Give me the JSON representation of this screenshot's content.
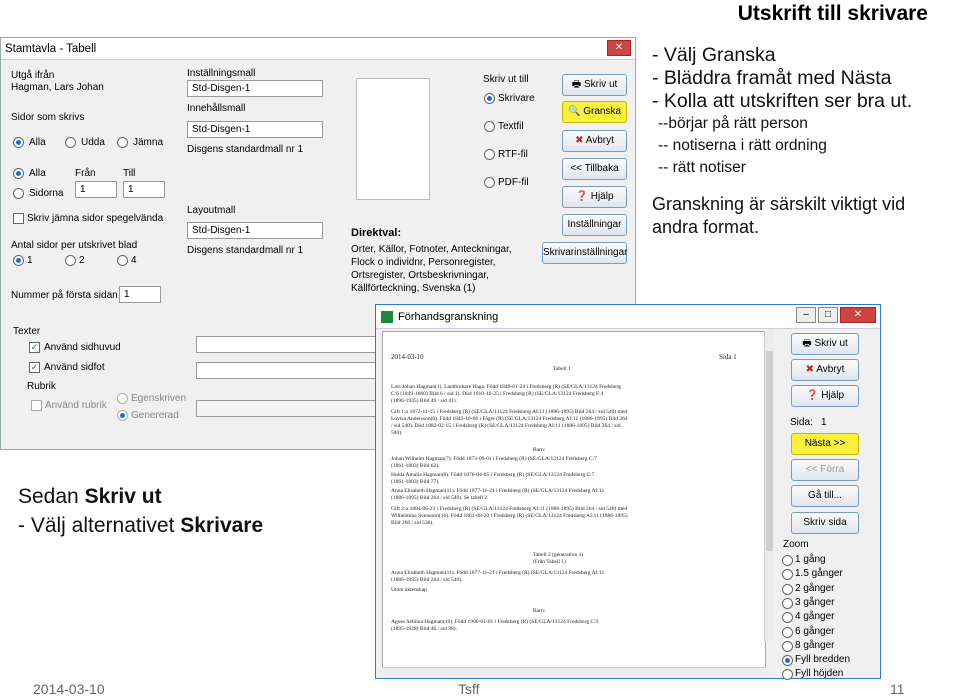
{
  "slide_title": "Utskrift till skrivare",
  "notes": {
    "l1": "- Välj Granska",
    "l2": "- Bläddra framåt med Nästa",
    "l3": "- Kolla att utskriften ser bra ut.",
    "s1": "--börjar på rätt person",
    "s2": "-- notiserna i rätt ordning",
    "s3": "-- rätt notiser",
    "para": "Granskning är särskilt viktigt vid andra format."
  },
  "bottom": {
    "l1a": "Sedan ",
    "l1b": "Skriv ut",
    "l2a": "- Välj alternativet ",
    "l2b": "Skrivare"
  },
  "footer": {
    "date": "2014-03-10",
    "center": "Tsff",
    "page": "11"
  },
  "dialog1": {
    "title": "Stamtavla - Tabell",
    "utgå_label": "Utgå ifrån",
    "utgå_value": "Hagman, Lars Johan",
    "sidor_label": "Sidor som skrivs",
    "alla": "Alla",
    "udda": "Udda",
    "jamna": "Jämna",
    "alla2": "Alla",
    "sidorna": "Sidorna",
    "fran": "Från",
    "fran_val": "1",
    "till": "Till",
    "till_val": "1",
    "skriv_jamna": "Skriv jämna sidor spegelvända",
    "antal_label": "Antal sidor per utskrivet blad",
    "a1": "1",
    "a2": "2",
    "a4": "4",
    "nummer_label": "Nummer på första sidan",
    "nummer_val": "1",
    "installningsmall_label": "Inställningsmall",
    "installningsmall_val": "Std-Disgen-1",
    "innehallsmall_label": "Innehållsmall",
    "innehallsmall_val": "Std-Disgen-1",
    "innehall_desc": "Disgens standardmall nr 1",
    "layoutmall_label": "Layoutmall",
    "layoutmall_val": "Std-Disgen-1",
    "layout_desc": "Disgens standardmall nr 1",
    "skriv_ut_till": "Skriv ut till",
    "skrivare": "Skrivare",
    "textfil": "Textfil",
    "rtf": "RTF-fil",
    "pdf": "PDF-fil",
    "btn_skriv": "Skriv ut",
    "btn_granska": "Granska",
    "btn_avbryt": "Avbryt",
    "btn_tillbaka": "<< Tillbaka",
    "btn_hjalp": "Hjälp",
    "btn_installningar": "Inställningar",
    "btn_skrivarinst": "Skrivarinställningar",
    "direktval_label": "Direktval:",
    "direktval_text": "Orter, Källor, Fotnoter, Anteckningar, Flock o individnr, Personregister, Ortsregister, Ortsbeskrivningar, Källförteckning, Svenska (1)",
    "texter_label": "Texter",
    "sidhuvud": "Använd sidhuvud",
    "sidfot": "Använd sidfot",
    "rubrik_label": "Rubrik",
    "anvand_rubrik": "Använd rubrik",
    "egenskriven": "Egenskriven",
    "genererad": "Genererad"
  },
  "dialog2": {
    "title": "Förhandsgranskning",
    "btn_skriv": "Skriv ut",
    "btn_avbryt": "Avbryt",
    "btn_hjalp": "Hjälp",
    "sida_label": "Sida:",
    "sida_val": "1",
    "btn_nasta": "Nästa >>",
    "btn_forra": "<< Förra",
    "btn_gatill": "Gå till...",
    "btn_skrivsida": "Skriv sida",
    "zoom_label": "Zoom",
    "zoom_options": [
      "1 gång",
      "1.5 gånger",
      "2 gånger",
      "3 gånger",
      "4 gånger",
      "6 gånger",
      "8 gånger",
      "Fyll bredden",
      "Fyll höjden"
    ],
    "page": {
      "date": "2014-03-10",
      "sida": "Sida 1",
      "tabell": "Tabell 1",
      "lines": [
        "Lars Johan Hagman(1). Lantbrukare Haga. Född 1849-01-24 i Fredsberg (R) (SE/GLA/13124 Fredsberg",
        "C:6 (1849-1860) Bild 6 / sid 1). Död 1910-10-25 i Fredsberg (R) (SE/GLA/13124 Fredsberg F:4",
        "(1896-1935) Bild 49 / sid 41).",
        "Gift 1:o 1872-11-15 i Fredsberg (R) (SE/GLA/13124 Fredsberg AI:11 (1886-1895) Bild 264 / sid 540) med",
        "Lovisa Andersson(6). Född 1845-10-06 i Fågre (R) (SE/GLA/13124 Fredsberg AI:11 (1886-1895) Bild 264",
        "/ sid 540). Död 1882-02-15 i Fredsberg (R) (SE/GLA/13124 Fredsberg AI:11 (1886-1895) Bild 264 / sid",
        "540).",
        "Barn:",
        "Johan Wilhelm Hagman(7). Född 1873-09-01 i Fredsberg (R) (SE/GLA/13124 Fredsberg C:7",
        "(1861-1883) Bild 62).",
        "Hulda Amalia Hagman(8). Född 1876-04-05 i Fredsberg (R) (SE/GLA/13124 Fredsberg C:7",
        "(1861-1883) Bild 77).",
        "Anna Elisabeth Hagman(11). Född 1877-11-21 i Fredsberg (R) (SE/GLA/13124 Fredsberg AI:11",
        "(1886-1895) Bild 264 / sid 540). Se tabell 2.",
        "Gift 2:o 1884-06-23 i Fredsberg (R) (SE/GLA/13124 Fredsberg AI:11 (1886-1895) Bild 264 / sid 540) med",
        "Wilhelmina Svensson(16). Född 1861-08-20 i Fredsberg (R) (SE/GLA/13124 Fredsberg AI:11 (1886-1895)",
        "Bild 266 / sid 536).",
        "Tabell 2 (generation 1)",
        "(Från Tabell 1)",
        "Anna Elisabeth Hagman(11). Född 1877-11-21 i Fredsberg (R) (SE/GLA/13124 Fredsberg AI:11",
        "(1886-1895) Bild 264 / sid 540).",
        "Utom äktenskap",
        "Barn:",
        "Agnes Sebiina Hagman(10). Född 1900-01-01 i Fredsberg (R) (SE/GLA/13124 Fredsberg C:9",
        "(1895-1928) Bild 46 / sid 38)."
      ]
    }
  },
  "colors": {
    "highlight": "#f8f03c",
    "titlebar_blue": "#2a7bc8",
    "radio_blue": "#1e6ec8"
  }
}
